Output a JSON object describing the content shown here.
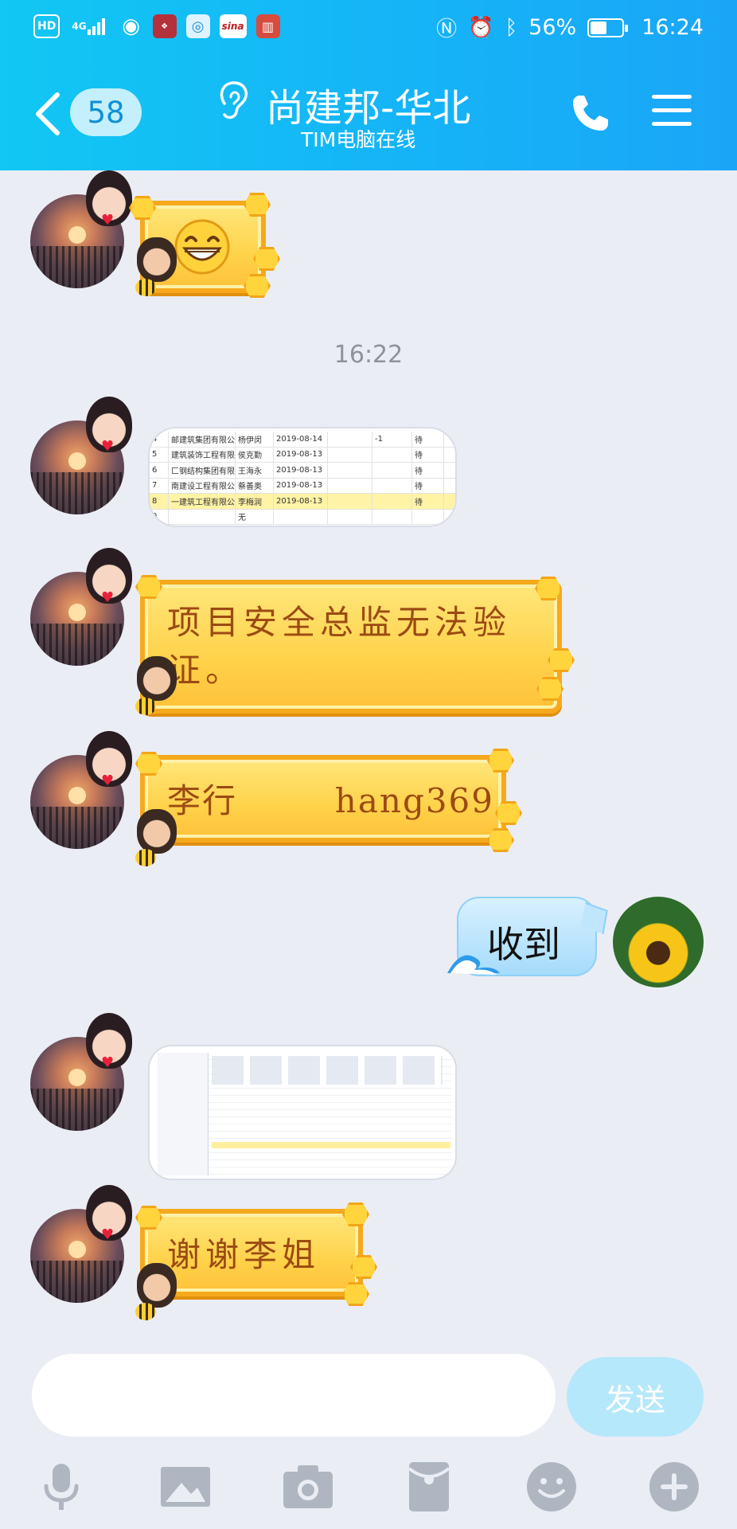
{
  "status_bar": {
    "left_icons": [
      "HD",
      "4G",
      "eye-icon",
      "app-icon-1",
      "app-icon-2",
      "sina",
      "app-icon-4"
    ],
    "battery_percent": "56%",
    "time": "16:24",
    "battery_level": 0.56
  },
  "header": {
    "unread_count": "58",
    "title": "尚建邦-华北",
    "subtitle": "TIM电脑在线",
    "accent_color": "#15b4f7"
  },
  "chat": {
    "timestamp": "16:22",
    "spreadsheet_rows": [
      {
        "no": "4",
        "company": "邮建筑集团有限公司",
        "name": "杨伊闵",
        "date": "2019-08-14",
        "extra": "-1",
        "tail": "待"
      },
      {
        "no": "5",
        "company": "建筑装饰工程有限",
        "name": "侯克勤",
        "date": "2019-08-13",
        "extra": "",
        "tail": "待"
      },
      {
        "no": "6",
        "company": "匚钢结构集团有限公",
        "name": "王海永",
        "date": "2019-08-13",
        "extra": "",
        "tail": "待"
      },
      {
        "no": "7",
        "company": "南建设工程有限公司",
        "name": "蔡善奥",
        "date": "2019-08-13",
        "extra": "",
        "tail": "待"
      },
      {
        "no": "8",
        "company": "一建筑工程有限公",
        "name": "李梅润",
        "date": "2019-08-13",
        "extra": "",
        "tail": "待"
      },
      {
        "no": "9",
        "company": "",
        "name": "无",
        "date": "",
        "extra": "",
        "tail": ""
      }
    ],
    "messages": [
      {
        "text": "项目安全总监无法验证。"
      },
      {
        "text": "李行        hang369"
      },
      {
        "text": "收到"
      },
      {
        "text": "谢谢李姐"
      }
    ]
  },
  "input": {
    "placeholder": "",
    "send_label": "发送"
  },
  "toolbar": {
    "items": [
      "microphone-icon",
      "image-icon",
      "camera-icon",
      "red-packet-icon",
      "emoji-icon",
      "plus-icon"
    ]
  }
}
